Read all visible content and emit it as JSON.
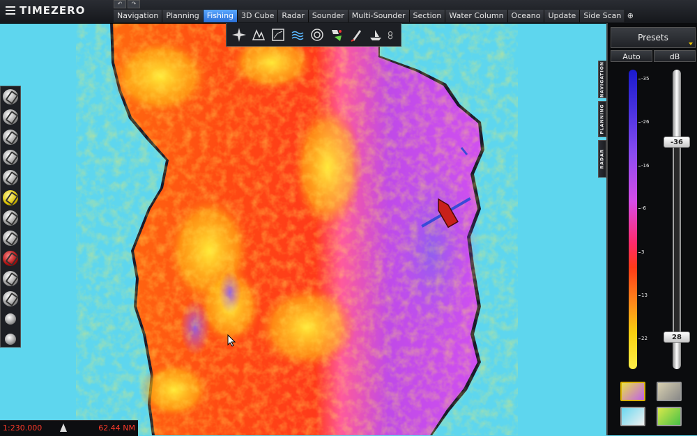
{
  "app": {
    "brand": "TIMEZERO"
  },
  "tabs": [
    {
      "label": "Navigation",
      "active": false
    },
    {
      "label": "Planning",
      "active": false
    },
    {
      "label": "Fishing",
      "active": true
    },
    {
      "label": "3D Cube",
      "active": false
    },
    {
      "label": "Radar",
      "active": false
    },
    {
      "label": "Sounder",
      "active": false
    },
    {
      "label": "Multi-Sounder",
      "active": false
    },
    {
      "label": "Section",
      "active": false
    },
    {
      "label": "Water Column",
      "active": false
    },
    {
      "label": "Oceano",
      "active": false
    },
    {
      "label": "Update",
      "active": false
    },
    {
      "label": "Side Scan",
      "active": false
    }
  ],
  "mode_toolbar": {
    "icons": [
      "compass-icon",
      "chart-icon",
      "frame-icon",
      "waves-icon",
      "target-icon",
      "fish-icon",
      "pen-icon",
      "boat-icon",
      "gear-icon"
    ]
  },
  "left_tools": {
    "icons": [
      "boat-tool-icon",
      "route-tool-icon",
      "mark-tool-icon",
      "zoom-in-icon",
      "zoom-out-icon",
      "hand-icon",
      "center-icon",
      "range-icon",
      "ais-icon",
      "measure-icon",
      "ebl-icon",
      "settings-a-icon",
      "settings-b-icon"
    ]
  },
  "status": {
    "scale": "1:230.000",
    "range": "62.44 NM"
  },
  "right_panel": {
    "presets_label": "Presets",
    "auto_label": "Auto",
    "db_label": "dB",
    "scale_ticks": [
      {
        "label": "-35"
      },
      {
        "label": "-26"
      },
      {
        "label": "-16"
      },
      {
        "label": "-6"
      },
      {
        "label": "3"
      },
      {
        "label": "13"
      },
      {
        "label": "22"
      }
    ],
    "upper_handle": "-36",
    "lower_handle": "28",
    "side_tabs": [
      "NAVIGATION",
      "PLANNING",
      "RADAR"
    ],
    "palette_tiles": [
      "palette-icon",
      "shaded-relief-icon",
      "contour-icon",
      "depth-shading-icon"
    ]
  },
  "colors": {
    "sea": "#5ed6ee",
    "active_tab": "#3a85ee",
    "scale_text": "#ff3a2a"
  }
}
